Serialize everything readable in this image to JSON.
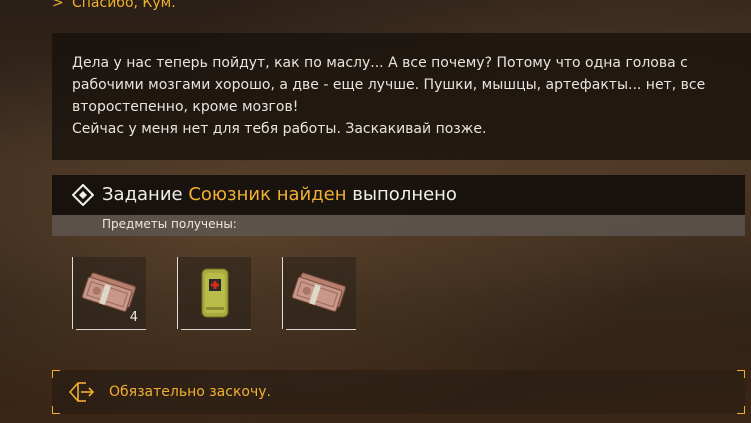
{
  "previous_reply": {
    "marker": ">",
    "text": "Спасибо, Кум."
  },
  "npc_text": {
    "lines": [
      "Дела у нас теперь пойдут, как по маслу... А все почему? Потому что одна голова с рабочими мозгами хорошо, а две - еще лучше. Пушки, мышцы, артефакты... нет, все второстепенно, кроме мозгов!",
      "Сейчас у меня нет для тебя работы. Заскакивай позже."
    ]
  },
  "quest": {
    "prefix": "Задание",
    "name": "Союзник найден",
    "status": "выполнено",
    "rewards_label": "Предметы получены:"
  },
  "rewards": [
    {
      "icon": "money-bundle-icon",
      "count": "4"
    },
    {
      "icon": "first-aid-kit-icon",
      "count": ""
    },
    {
      "icon": "money-bundle-icon",
      "count": ""
    }
  ],
  "answer": {
    "text": "Обязательно заскочу.",
    "icon": "exit-dialog-icon"
  },
  "colors": {
    "accent": "#f0b030",
    "text": "#e8e4de"
  }
}
